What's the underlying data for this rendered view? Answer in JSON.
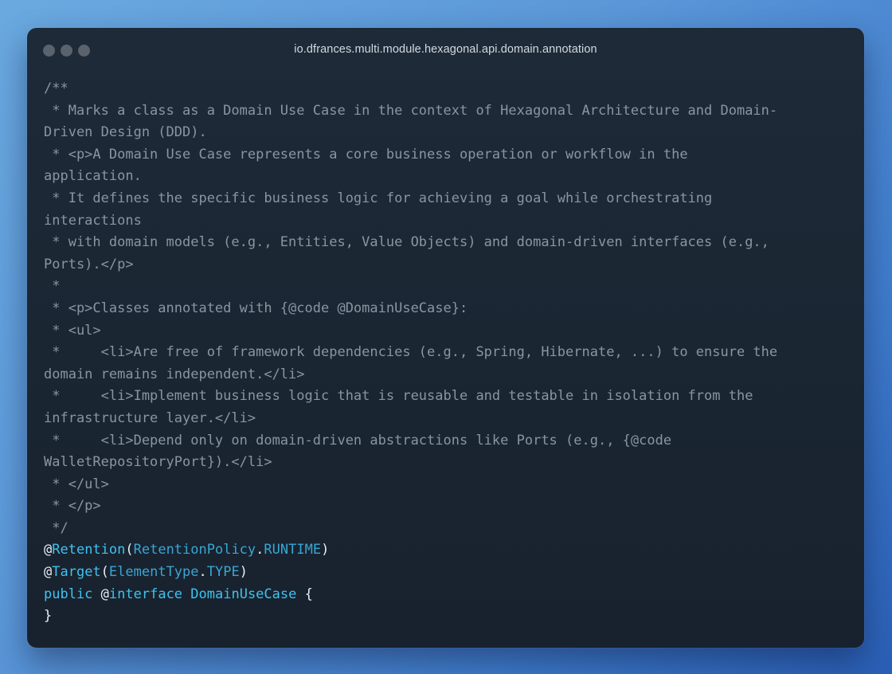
{
  "window": {
    "title": "io.dfrances.multi.module.hexagonal.api.domain.annotation"
  },
  "code": {
    "comment_lines": [
      "/**",
      " * Marks a class as a Domain Use Case in the context of Hexagonal Architecture and Domain-",
      "Driven Design (DDD).",
      " * <p>A Domain Use Case represents a core business operation or workflow in the",
      "application.",
      " * It defines the specific business logic for achieving a goal while orchestrating",
      "interactions",
      " * with domain models (e.g., Entities, Value Objects) and domain-driven interfaces (e.g.,",
      "Ports).</p>",
      " *",
      " * <p>Classes annotated with {@code @DomainUseCase}:",
      " * <ul>",
      " *     <li>Are free of framework dependencies (e.g., Spring, Hibernate, ...) to ensure the",
      "domain remains independent.</li>",
      " *     <li>Implement business logic that is reusable and testable in isolation from the",
      "infrastructure layer.</li>",
      " *     <li>Depend only on domain-driven abstractions like Ports (e.g., {@code",
      "WalletRepositoryPort}).</li>",
      " * </ul>",
      " * </p>",
      " */"
    ],
    "retention": {
      "at": "@",
      "name": "Retention",
      "open": "(",
      "type": "RetentionPolicy",
      "dot": ".",
      "value": "RUNTIME",
      "close": ")"
    },
    "target": {
      "at": "@",
      "name": "Target",
      "open": "(",
      "type": "ElementType",
      "dot": ".",
      "value": "TYPE",
      "close": ")"
    },
    "declaration": {
      "kw_public": "public",
      "space1": " ",
      "at": "@",
      "kw_interface": "interface",
      "space2": " ",
      "name": "DomainUseCase",
      "brace_open": " {"
    },
    "closing_brace": "}"
  },
  "colors": {
    "comment": "#8a95a3",
    "keyword": "#3fc2ee",
    "type": "#3aa6d3",
    "plain": "#e8edf2"
  }
}
